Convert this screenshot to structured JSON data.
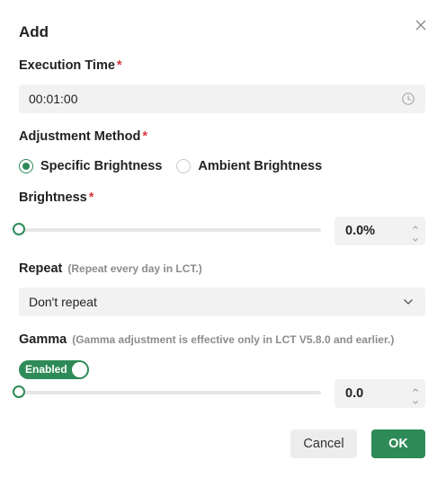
{
  "dialog": {
    "title": "Add",
    "close_icon": "close-icon"
  },
  "execution_time": {
    "label": "Execution Time",
    "required_mark": "*",
    "value": "00:01:00",
    "icon": "clock-icon"
  },
  "adjustment_method": {
    "label": "Adjustment Method",
    "required_mark": "*",
    "options": [
      {
        "label": "Specific Brightness",
        "selected": true
      },
      {
        "label": "Ambient Brightness",
        "selected": false
      }
    ]
  },
  "brightness": {
    "label": "Brightness",
    "required_mark": "*",
    "value": "0.0%",
    "slider_value_percent": 0
  },
  "repeat": {
    "label": "Repeat",
    "hint": "(Repeat every day in LCT.)",
    "selected": "Don't repeat",
    "icon": "chevron-down-icon"
  },
  "gamma": {
    "label": "Gamma",
    "hint": "(Gamma adjustment is effective only in LCT V5.8.0 and earlier.)",
    "toggle_label": "Enabled",
    "enabled": true,
    "value": "0.0",
    "slider_value_percent": 0
  },
  "footer": {
    "cancel_label": "Cancel",
    "ok_label": "OK"
  },
  "colors": {
    "accent": "#2e8b57",
    "required": "#d9363e",
    "field_bg": "#f2f2f2"
  }
}
